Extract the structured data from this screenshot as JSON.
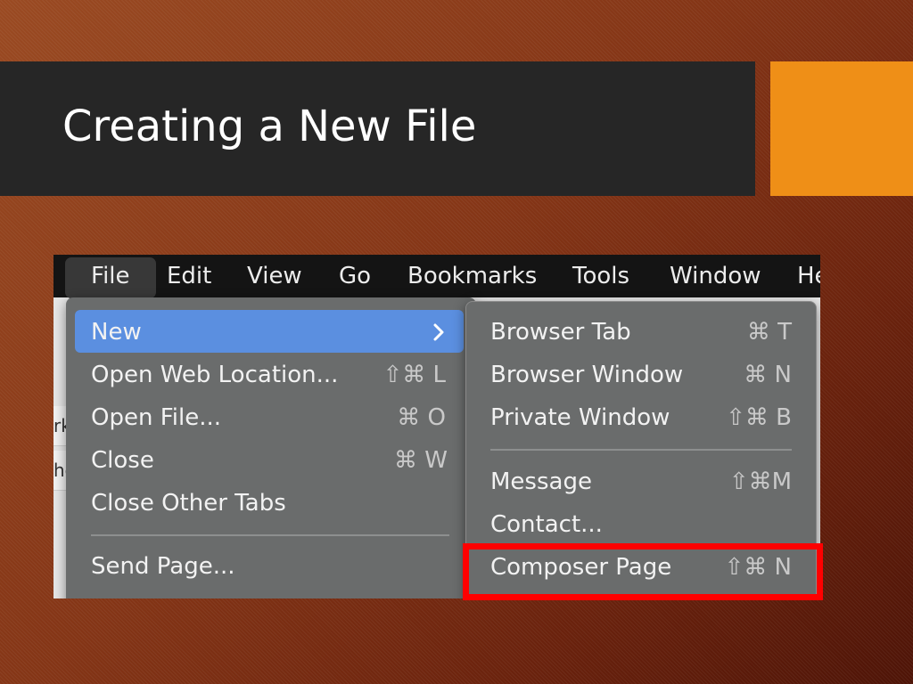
{
  "slide": {
    "title": "Creating a New File",
    "colors": {
      "title_bar": "#262626",
      "accent": "#ef8f17",
      "highlight_box": "#ff0000",
      "selection": "#5b8fe0"
    }
  },
  "menubar": {
    "items": [
      "File",
      "Edit",
      "View",
      "Go",
      "Bookmarks",
      "Tools",
      "Window",
      "He"
    ]
  },
  "background_fragments": [
    "rk",
    "he"
  ],
  "file_menu": {
    "items": [
      {
        "label": "New",
        "shortcut": ""
      },
      {
        "label": "Open Web Location...",
        "shortcut": "⇧⌘ L"
      },
      {
        "label": "Open File...",
        "shortcut": "⌘ O"
      },
      {
        "label": "Close",
        "shortcut": "⌘ W"
      },
      {
        "label": "Close Other Tabs",
        "shortcut": ""
      },
      {
        "label": "Send Page...",
        "shortcut": ""
      }
    ],
    "submenu_icon": "chevron-right-icon"
  },
  "new_submenu": {
    "items": [
      {
        "label": "Browser Tab",
        "shortcut": "⌘ T"
      },
      {
        "label": "Browser Window",
        "shortcut": "⌘ N"
      },
      {
        "label": "Private Window",
        "shortcut": "⇧⌘ B"
      },
      {
        "label": "Message",
        "shortcut": "⇧⌘M"
      },
      {
        "label": "Contact...",
        "shortcut": ""
      },
      {
        "label": "Composer Page",
        "shortcut": "⇧⌘ N"
      }
    ]
  }
}
